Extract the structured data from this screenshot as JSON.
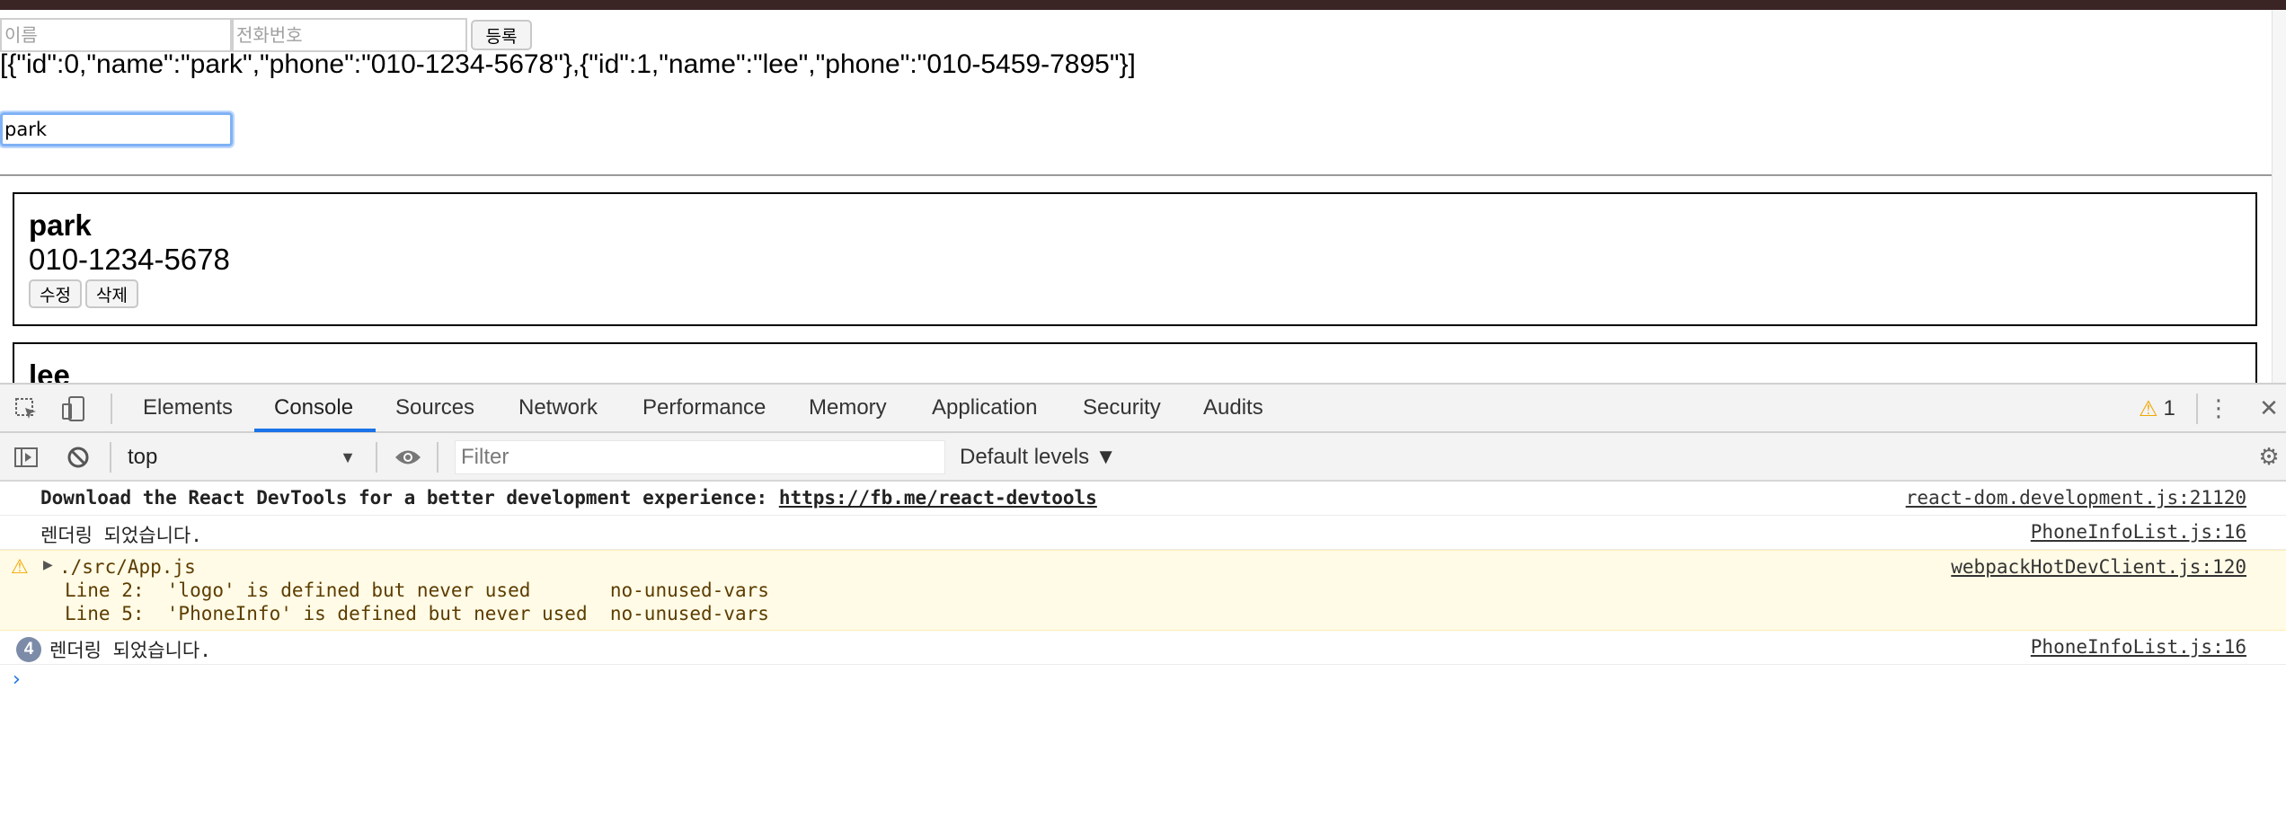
{
  "form": {
    "name_placeholder": "이름",
    "phone_placeholder": "전화번호",
    "register_label": "등록"
  },
  "json_dump": "[{\"id\":0,\"name\":\"park\",\"phone\":\"010-1234-5678\"},{\"id\":1,\"name\":\"lee\",\"phone\":\"010-5459-7895\"}]",
  "search": {
    "value": "park"
  },
  "cards": [
    {
      "name": "park",
      "phone": "010-1234-5678",
      "edit_label": "수정",
      "delete_label": "삭제"
    },
    {
      "name": "lee"
    }
  ],
  "devtools": {
    "tabs": [
      "Elements",
      "Console",
      "Sources",
      "Network",
      "Performance",
      "Memory",
      "Application",
      "Security",
      "Audits"
    ],
    "active_tab": "Console",
    "warning_count": "1",
    "context": "top",
    "filter_placeholder": "Filter",
    "levels_label": "Default levels ▼",
    "accent_color": "#1a73e8",
    "warning_color": "#f2a600",
    "messages": [
      {
        "text": "Download the React DevTools for a better development experience: ",
        "link": "https://fb.me/react-devtools",
        "source": "react-dom.development.js:21120"
      },
      {
        "text": "렌더링 되었습니다.",
        "source": "PhoneInfoList.js:16"
      },
      {
        "title": "./src/App.js",
        "lines": [
          "Line 2:  'logo' is defined but never used       no-unused-vars",
          "Line 5:  'PhoneInfo' is defined but never used  no-unused-vars"
        ],
        "source": "webpackHotDevClient.js:120"
      },
      {
        "count": "4",
        "text": "렌더링 되었습니다.",
        "source": "PhoneInfoList.js:16"
      }
    ]
  }
}
